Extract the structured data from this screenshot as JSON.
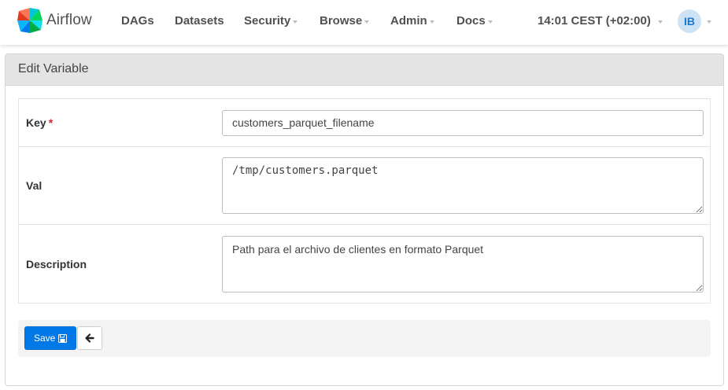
{
  "navbar": {
    "brand": "Airflow",
    "items": [
      {
        "label": "DAGs",
        "dropdown": false
      },
      {
        "label": "Datasets",
        "dropdown": false
      },
      {
        "label": "Security",
        "dropdown": true
      },
      {
        "label": "Browse",
        "dropdown": true
      },
      {
        "label": "Admin",
        "dropdown": true
      },
      {
        "label": "Docs",
        "dropdown": true
      }
    ],
    "clock": "14:01 CEST (+02:00)",
    "user_initials": "IB"
  },
  "panel": {
    "title": "Edit Variable"
  },
  "form": {
    "key": {
      "label": "Key",
      "required_mark": "*",
      "value": "customers_parquet_filename"
    },
    "val": {
      "label": "Val",
      "value": "/tmp/customers.parquet"
    },
    "description": {
      "label": "Description",
      "value": "Path para el archivo de clientes en formato Parquet"
    }
  },
  "actions": {
    "save_label": "Save",
    "save_icon": "floppy-disk-icon",
    "back_icon": "arrow-left-icon"
  },
  "colors": {
    "primary": "#0078e7",
    "avatar_bg": "#cde3f5",
    "avatar_text": "#1e78c8",
    "required": "#d9232d",
    "panel_heading_bg": "#e4e4e4"
  }
}
